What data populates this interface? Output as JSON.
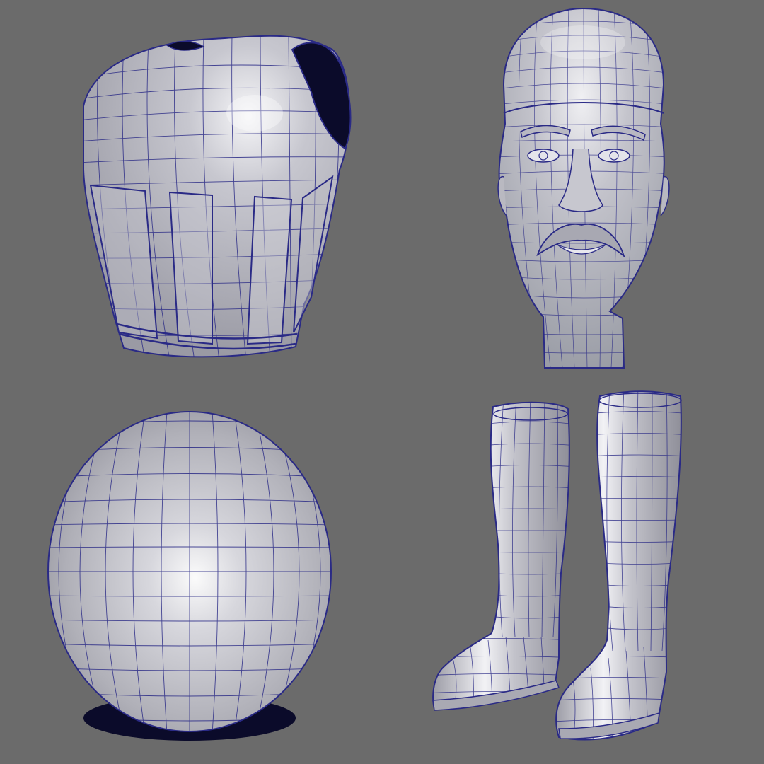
{
  "viewport": {
    "background": "#6b6b6b",
    "shading": {
      "highlight": "#fafafa",
      "base": "#b7b7bf",
      "shadow": "#8a8a94",
      "wire": "#2a2a86",
      "cavity": "#0b0b2a"
    },
    "models": [
      {
        "id": "torso",
        "kind": "armor-vest"
      },
      {
        "id": "head",
        "kind": "human-head"
      },
      {
        "id": "sphere",
        "kind": "ball"
      },
      {
        "id": "boots",
        "kind": "boot-pair"
      }
    ]
  }
}
